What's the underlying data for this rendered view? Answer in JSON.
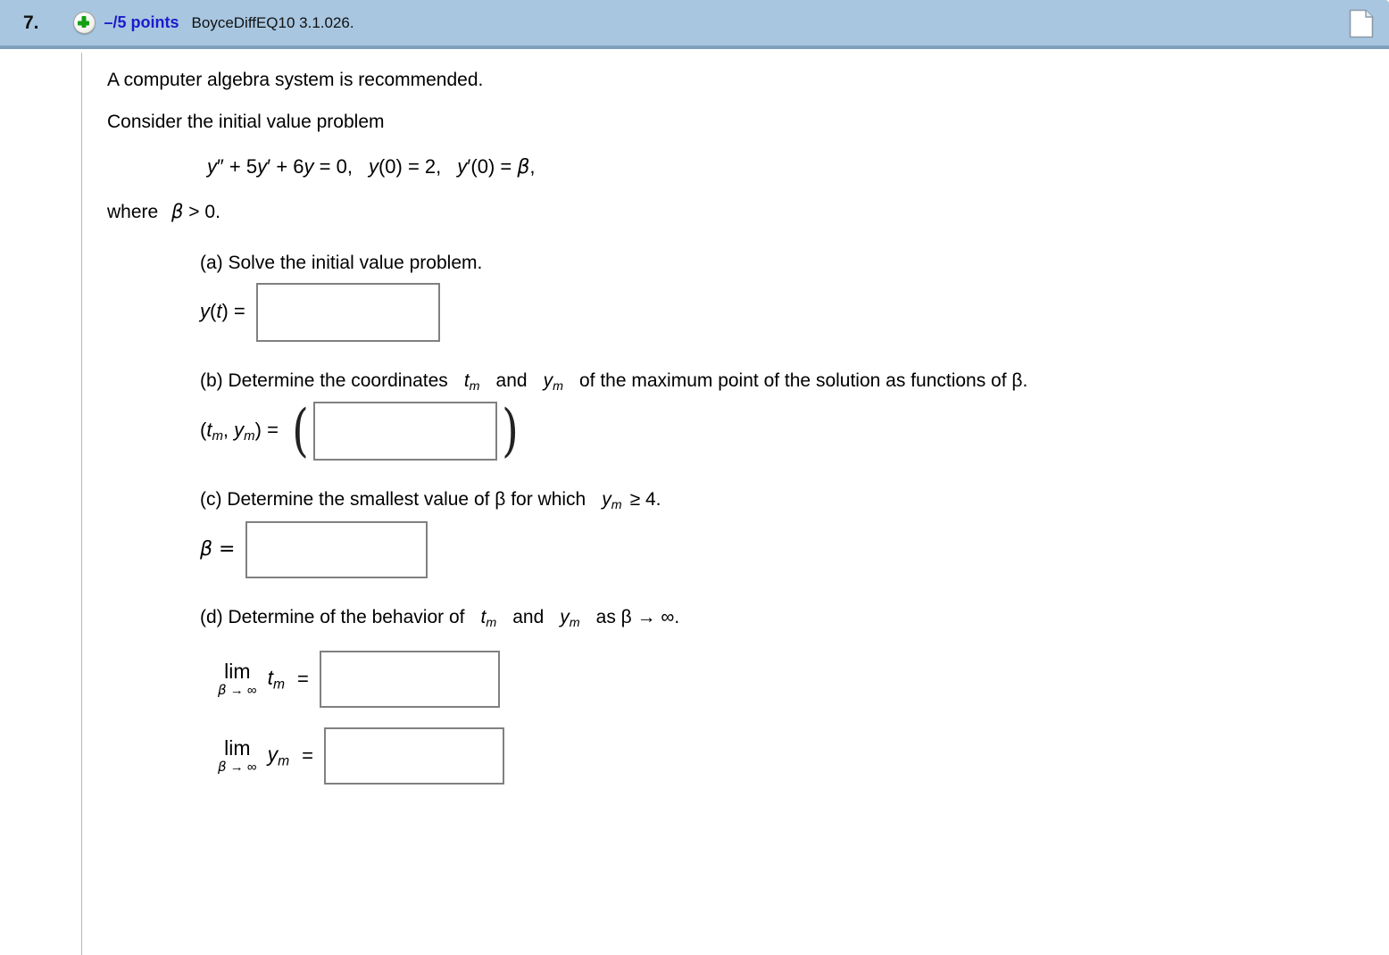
{
  "header": {
    "question_number": "7.",
    "add_icon": "plus-circle-icon",
    "points": "–/5 points",
    "source": "BoyceDiffEQ10 3.1.026.",
    "page_icon": "document-page-icon",
    "background_color": "#a8c6e0",
    "points_color": "#1b1bcc"
  },
  "body": {
    "note": "A computer algebra system is recommended.",
    "intro": "Consider the initial value problem",
    "equation": "y″ + 5y′ + 6y = 0,   y(0) = 2,   y′(0) = β,",
    "where_prefix": "where",
    "where_condition": "β > 0.",
    "parts": [
      {
        "id": "a",
        "label": "(a) Solve the initial value problem.",
        "answer_prefix": "y(t) =",
        "answer_value": "",
        "box_name": "answer-box-a"
      },
      {
        "id": "b",
        "label_1": "(b) Determine the coordinates",
        "label_var_1": "t",
        "label_sub_1": "m",
        "label_2": "and",
        "label_var_2": "y",
        "label_sub_2": "m",
        "label_3": "of the maximum point of the solution as functions of β.",
        "answer_prefix": "(tₘ, yₘ) =",
        "answer_value": "",
        "box_name": "answer-box-b",
        "left_paren": "(",
        "right_paren": ")"
      },
      {
        "id": "c",
        "label_1": "(c) Determine the smallest value of β for which",
        "label_var": "y",
        "label_sub": "m",
        "label_2": "≥ 4.",
        "answer_prefix": "β =",
        "answer_value": "",
        "box_name": "answer-box-c"
      },
      {
        "id": "d",
        "label_1": "(d) Determine of the behavior of",
        "label_var_1": "t",
        "label_sub_1": "m",
        "label_2": "and",
        "label_var_2": "y",
        "label_sub_2": "m",
        "label_3": "as β → ∞.",
        "limits": [
          {
            "lim_text": "lim",
            "lim_under": "β → ∞",
            "variable": "t",
            "subscript": "m",
            "equals": "=",
            "answer_value": "",
            "box_name": "answer-box-d-tm"
          },
          {
            "lim_text": "lim",
            "lim_under": "β → ∞",
            "variable": "y",
            "subscript": "m",
            "equals": "=",
            "answer_value": "",
            "box_name": "answer-box-d-ym"
          }
        ]
      }
    ]
  }
}
